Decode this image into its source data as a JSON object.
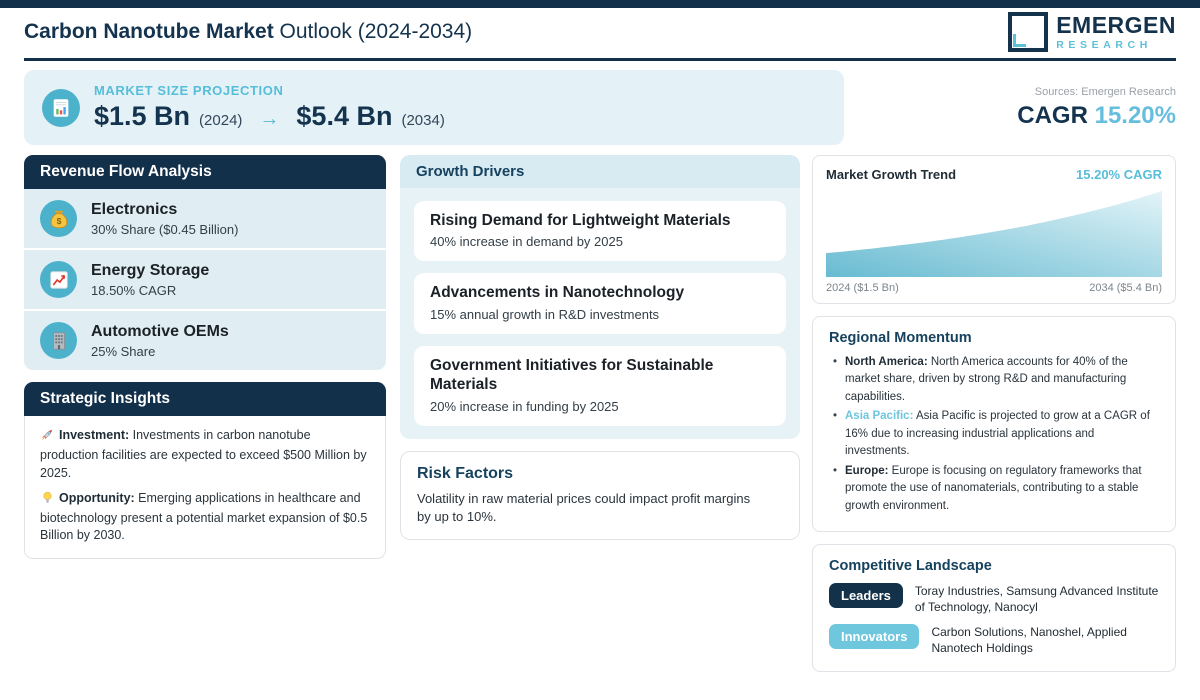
{
  "header": {
    "title_bold": "Carbon Nanotube Market",
    "title_rest": " Outlook (2024-2034)",
    "logo_line1": "EMERGEN",
    "logo_line2": "RESEARCH"
  },
  "projection": {
    "label": "MARKET SIZE PROJECTION",
    "start_value": "$1.5 Bn",
    "start_year": "(2024)",
    "arrow": "→",
    "end_value": "$5.4 Bn",
    "end_year": "(2034)",
    "sources": "Sources: Emergen Research",
    "cagr_label": "CAGR ",
    "cagr_value": "15.20%"
  },
  "revenue": {
    "title": "Revenue Flow Analysis",
    "items": [
      {
        "icon": "money-bag-icon",
        "title": "Electronics",
        "subtitle": "30% Share ($0.45 Billion)"
      },
      {
        "icon": "chart-up-icon",
        "title": "Energy Storage",
        "subtitle": "18.50% CAGR"
      },
      {
        "icon": "building-icon",
        "title": "Automotive OEMs",
        "subtitle": "25% Share"
      }
    ]
  },
  "strategic": {
    "title": "Strategic Insights",
    "items": [
      {
        "icon": "rocket-icon",
        "label": "Investment:",
        "text": " Investments in carbon nanotube production facilities are expected to exceed $500 Million by 2025."
      },
      {
        "icon": "bulb-icon",
        "label": "Opportunity:",
        "text": " Emerging applications in healthcare and biotechnology present a potential market expansion of $0.5 Billion by 2030."
      }
    ]
  },
  "growth": {
    "title": "Growth Drivers",
    "cards": [
      {
        "title": "Rising Demand for Lightweight Materials",
        "subtitle": "40% increase in demand by 2025"
      },
      {
        "title": "Advancements in Nanotechnology",
        "subtitle": "15% annual growth in R&D investments"
      },
      {
        "title": "Government Initiatives for Sustainable Materials",
        "subtitle": "20% increase in funding by 2025"
      }
    ]
  },
  "risk": {
    "title": "Risk Factors",
    "text": "Volatility in raw material prices could impact profit margins by up to 10%."
  },
  "trend": {
    "title": "Market Growth Trend",
    "cagr": "15.20% CAGR",
    "label_left": "2024 ($1.5 Bn)",
    "label_right": "2034 ($5.4 Bn)"
  },
  "chart_data": {
    "type": "area",
    "title": "Market Growth Trend",
    "x": [
      2024,
      2025,
      2026,
      2027,
      2028,
      2029,
      2030,
      2031,
      2032,
      2033,
      2034
    ],
    "values": [
      1.5,
      1.7,
      1.94,
      2.2,
      2.5,
      2.85,
      3.23,
      3.68,
      4.18,
      4.75,
      5.4
    ],
    "unit": "USD Billion",
    "cagr_pct": 15.2,
    "xlabel": "",
    "ylabel": "",
    "ylim": [
      0,
      5.4
    ],
    "grid": false,
    "legend": "none",
    "fill_start": "#68bbd1",
    "fill_end": "#e3f4f8"
  },
  "regional": {
    "title": "Regional Momentum",
    "bullets": [
      {
        "label": "North America:",
        "text": " North America accounts for 40% of the market share, driven by strong R&D and manufacturing capabilities.",
        "label_color": "#1f2c36"
      },
      {
        "label": "Asia Pacific:",
        "text": " Asia Pacific is projected to grow at a CAGR of 16% due to increasing industrial applications and investments.",
        "label_color": "#6cc6de"
      },
      {
        "label": "Europe:",
        "text": " Europe is focusing on regulatory frameworks that promote the use of nanomaterials, contributing to a stable growth environment.",
        "label_color": "#1f2c36"
      }
    ]
  },
  "competitive": {
    "title": "Competitive Landscape",
    "rows": [
      {
        "badge": "Leaders",
        "badge_color": "#13324a",
        "companies": "Toray Industries, Samsung Advanced Institute of Technology, Nanocyl"
      },
      {
        "badge": "Innovators",
        "badge_color": "#6fc7de",
        "companies": "Carbon Solutions, Nanoshel, Applied Nanotech Holdings"
      }
    ]
  },
  "colors": {
    "navy": "#13304a",
    "teal_accent": "#56bed9",
    "panel_blue": "#e4f1f6"
  }
}
